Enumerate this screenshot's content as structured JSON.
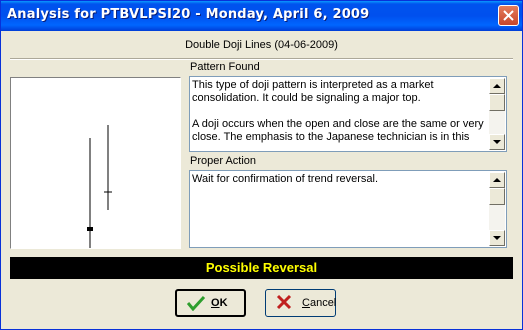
{
  "window": {
    "title": "Analysis for PTBVLPSI20 - Monday, April 6, 2009"
  },
  "header": {
    "pattern_title": "Double Doji Lines (04-06-2009)"
  },
  "pattern_found": {
    "label": "Pattern Found",
    "paragraphs": [
      "This type of doji pattern is interpreted as a market consolidation. It could be signaling a major top.",
      "A doji occurs when the open and close are the same or very close. The emphasis to the Japanese technician is in this"
    ]
  },
  "proper_action": {
    "label": "Proper Action",
    "text": "Wait for confirmation of trend reversal."
  },
  "banner": {
    "text": "Possible Reversal",
    "background": "#000000",
    "color": "#ffff00"
  },
  "buttons": {
    "ok": {
      "label_underlined": "O",
      "label_rest": "K",
      "icon": "checkmark-icon"
    },
    "cancel": {
      "label_underlined": "C",
      "label_rest": "ancel",
      "icon": "x-icon"
    }
  },
  "colors": {
    "titlebar": "#0054e3",
    "accent_check": "#2e9e2e",
    "accent_x": "#c0201f"
  }
}
